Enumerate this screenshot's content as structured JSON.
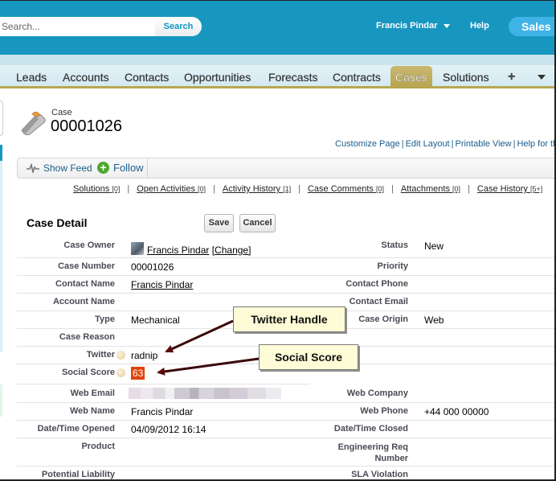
{
  "header": {
    "search_placeholder": "Search...",
    "search_button": "Search",
    "user_name": "Francis Pindar",
    "help": "Help",
    "app_name": "Sales",
    "brand_color": "#1797c0"
  },
  "tabs": [
    {
      "label": "Leads"
    },
    {
      "label": "Accounts"
    },
    {
      "label": "Contacts"
    },
    {
      "label": "Opportunities"
    },
    {
      "label": "Forecasts"
    },
    {
      "label": "Contracts"
    },
    {
      "label": "Cases",
      "active": true
    },
    {
      "label": "Solutions"
    },
    {
      "label": "+"
    }
  ],
  "case": {
    "object_label": "Case",
    "number": "00001026"
  },
  "page_links": [
    "Customize Page",
    "Edit Layout",
    "Printable View",
    "Help for th"
  ],
  "feed": {
    "show_feed": "Show Feed",
    "follow": "Follow"
  },
  "related_lists": [
    {
      "label": "Solutions",
      "count": "[0]"
    },
    {
      "label": "Open Activities",
      "count": "[0]"
    },
    {
      "label": "Activity History",
      "count": "[1]"
    },
    {
      "label": "Case Comments",
      "count": "[0]"
    },
    {
      "label": "Attachments",
      "count": "[0]"
    },
    {
      "label": "Case History",
      "count": "[5+]"
    }
  ],
  "detail": {
    "title": "Case Detail",
    "save": "Save",
    "cancel": "Cancel",
    "change_link": "[Change]",
    "fields": {
      "case_owner": {
        "label": "Case Owner",
        "value": "Francis Pindar"
      },
      "status": {
        "label": "Status",
        "value": "New"
      },
      "case_number": {
        "label": "Case Number",
        "value": "00001026"
      },
      "priority": {
        "label": "Priority",
        "value": ""
      },
      "contact_name": {
        "label": "Contact Name",
        "value": "Francis Pindar"
      },
      "contact_phone": {
        "label": "Contact Phone",
        "value": ""
      },
      "account_name": {
        "label": "Account Name",
        "value": ""
      },
      "contact_email": {
        "label": "Contact Email",
        "value": ""
      },
      "type": {
        "label": "Type",
        "value": "Mechanical"
      },
      "case_origin": {
        "label": "Case Origin",
        "value": "Web"
      },
      "case_reason": {
        "label": "Case Reason",
        "value": ""
      },
      "twitter": {
        "label": "Twitter",
        "value": "radnip"
      },
      "social_score": {
        "label": "Social Score",
        "value": "63",
        "badge_color": "#e0450c"
      },
      "web_email": {
        "label": "Web Email",
        "value": "(blurred)"
      },
      "web_company": {
        "label": "Web Company",
        "value": ""
      },
      "web_name": {
        "label": "Web Name",
        "value": "Francis Pindar"
      },
      "web_phone": {
        "label": "Web Phone",
        "value": "+44 000 00000"
      },
      "date_opened": {
        "label": "Date/Time Opened",
        "value": "04/09/2012 16:14"
      },
      "date_closed": {
        "label": "Date/Time Closed",
        "value": ""
      },
      "product": {
        "label": "Product",
        "value": ""
      },
      "engineering_req": {
        "label": "Engineering Req Number",
        "value": ""
      },
      "potential_liability": {
        "label": "Potential Liability",
        "value": ""
      },
      "sla_violation": {
        "label": "SLA Violation",
        "value": ""
      }
    }
  },
  "callouts": {
    "twitter": "Twitter Handle",
    "social_score": "Social Score"
  }
}
